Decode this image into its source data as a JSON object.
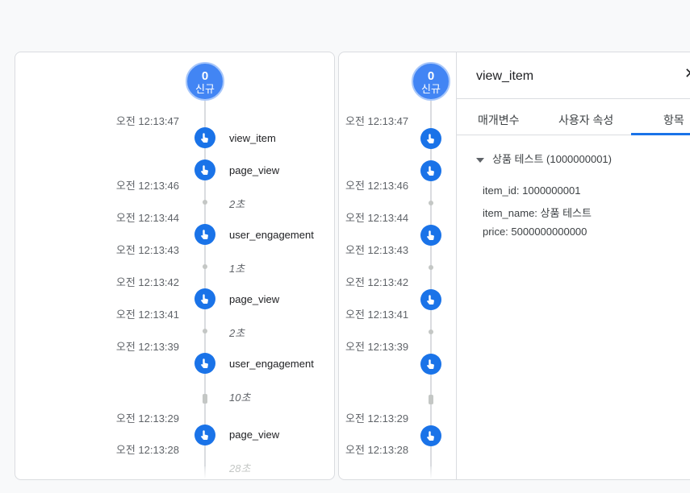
{
  "badge": {
    "count": "0",
    "label": "신규"
  },
  "left": {
    "timestamps": [
      "오전 12:13:47",
      "오전 12:13:46",
      "오전 12:13:44",
      "오전 12:13:43",
      "오전 12:13:42",
      "오전 12:13:41",
      "오전 12:13:39",
      "오전 12:13:29",
      "오전 12:13:28"
    ],
    "events": [
      "view_item",
      "page_view",
      "user_engagement",
      "page_view",
      "user_engagement",
      "page_view"
    ],
    "gaps": [
      "2초",
      "1초",
      "2초",
      "10초",
      "28초"
    ]
  },
  "right": {
    "timestamps": [
      "오전 12:13:47",
      "오전 12:13:46",
      "오전 12:13:44",
      "오전 12:13:43",
      "오전 12:13:42",
      "오전 12:13:41",
      "오전 12:13:39",
      "오전 12:13:29",
      "오전 12:13:28"
    ]
  },
  "detail": {
    "title": "view_item",
    "close": "✕",
    "tabs": [
      "매개변수",
      "사용자 속성",
      "항목"
    ],
    "section": "상품 테스트 (1000000001)",
    "params": [
      "item_id: 1000000001",
      "item_name: 상품 테스트",
      "price: 5000000000000"
    ]
  },
  "icon_names": {
    "event": "touch-icon",
    "collapse": "triangle-down-icon",
    "close": "close-icon"
  },
  "colors": {
    "accent": "#1a73e8",
    "badge": "#4285f4"
  }
}
